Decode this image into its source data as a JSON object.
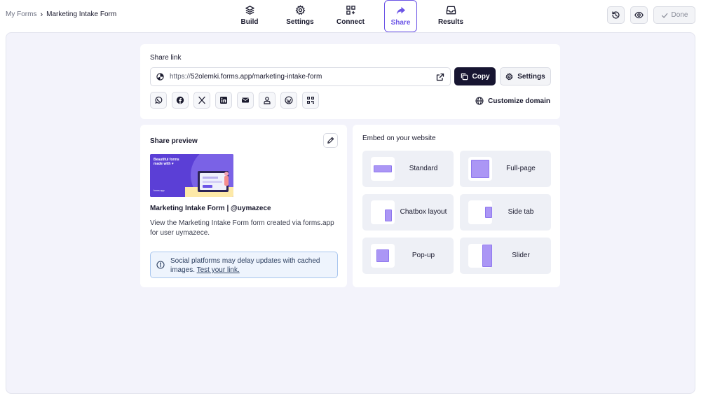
{
  "breadcrumb": {
    "root": "My Forms",
    "separator": "›",
    "current": "Marketing Intake Form"
  },
  "nav": {
    "tabs": [
      {
        "label": "Build",
        "icon": "layers-icon"
      },
      {
        "label": "Settings",
        "icon": "gear-icon"
      },
      {
        "label": "Connect",
        "icon": "grid-plus-icon"
      },
      {
        "label": "Share",
        "icon": "share-arrow-icon",
        "active": true
      },
      {
        "label": "Results",
        "icon": "inbox-icon"
      }
    ]
  },
  "toolbar": {
    "history_icon": "history-icon",
    "preview_icon": "eye-icon",
    "done_label": "Done"
  },
  "share_link": {
    "title": "Share link",
    "url_protocol": "https://",
    "url_rest": "52olemki.forms.app/marketing-intake-form",
    "copy_label": "Copy",
    "settings_label": "Settings",
    "social": [
      "whatsapp-icon",
      "facebook-icon",
      "x-icon",
      "linkedin-icon",
      "email-icon",
      "user-icon",
      "wordpress-icon",
      "qr-code-icon"
    ],
    "customize_domain_label": "Customize domain"
  },
  "share_preview": {
    "title": "Share preview",
    "thumbnail_text": "Beautiful forms made with ♥",
    "thumbnail_logo": "forms.app",
    "name": "Marketing Intake Form | @uymazece",
    "description": "View the Marketing Intake Form form created via forms.app for user uymazece.",
    "info_text": "Social platforms may delay updates with cached images.",
    "info_link": "Test your link."
  },
  "embed": {
    "title": "Embed on your website",
    "options": [
      {
        "label": "Standard"
      },
      {
        "label": "Full-page"
      },
      {
        "label": "Chatbox layout"
      },
      {
        "label": "Side tab"
      },
      {
        "label": "Pop-up"
      },
      {
        "label": "Slider"
      }
    ]
  },
  "colors": {
    "accent": "#6c55e6",
    "dark_button": "#171531",
    "workspace_bg": "#f3f3fb",
    "embed_shape": "#ab96f5"
  }
}
